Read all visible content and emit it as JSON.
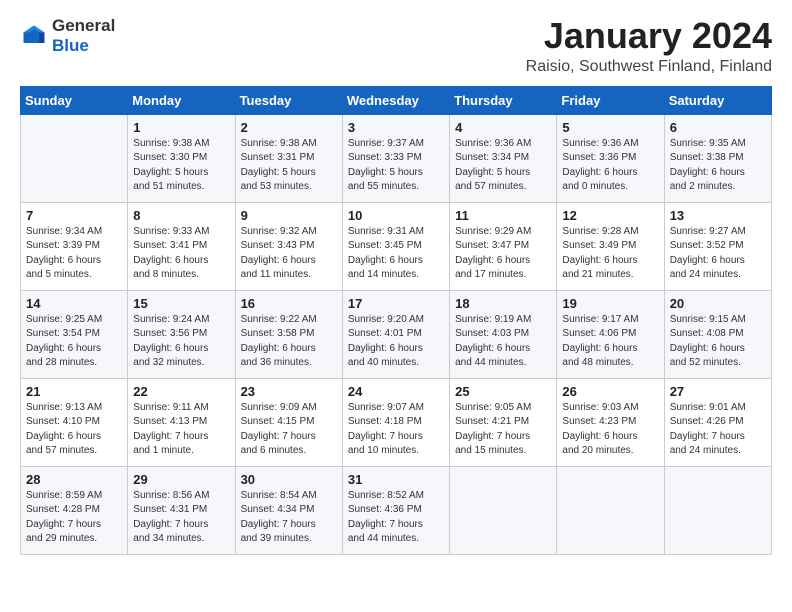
{
  "header": {
    "logo_general": "General",
    "logo_blue": "Blue",
    "month": "January 2024",
    "location": "Raisio, Southwest Finland, Finland"
  },
  "days_of_week": [
    "Sunday",
    "Monday",
    "Tuesday",
    "Wednesday",
    "Thursday",
    "Friday",
    "Saturday"
  ],
  "weeks": [
    [
      {
        "day": "",
        "info": ""
      },
      {
        "day": "1",
        "info": "Sunrise: 9:38 AM\nSunset: 3:30 PM\nDaylight: 5 hours\nand 51 minutes."
      },
      {
        "day": "2",
        "info": "Sunrise: 9:38 AM\nSunset: 3:31 PM\nDaylight: 5 hours\nand 53 minutes."
      },
      {
        "day": "3",
        "info": "Sunrise: 9:37 AM\nSunset: 3:33 PM\nDaylight: 5 hours\nand 55 minutes."
      },
      {
        "day": "4",
        "info": "Sunrise: 9:36 AM\nSunset: 3:34 PM\nDaylight: 5 hours\nand 57 minutes."
      },
      {
        "day": "5",
        "info": "Sunrise: 9:36 AM\nSunset: 3:36 PM\nDaylight: 6 hours\nand 0 minutes."
      },
      {
        "day": "6",
        "info": "Sunrise: 9:35 AM\nSunset: 3:38 PM\nDaylight: 6 hours\nand 2 minutes."
      }
    ],
    [
      {
        "day": "7",
        "info": "Sunrise: 9:34 AM\nSunset: 3:39 PM\nDaylight: 6 hours\nand 5 minutes."
      },
      {
        "day": "8",
        "info": "Sunrise: 9:33 AM\nSunset: 3:41 PM\nDaylight: 6 hours\nand 8 minutes."
      },
      {
        "day": "9",
        "info": "Sunrise: 9:32 AM\nSunset: 3:43 PM\nDaylight: 6 hours\nand 11 minutes."
      },
      {
        "day": "10",
        "info": "Sunrise: 9:31 AM\nSunset: 3:45 PM\nDaylight: 6 hours\nand 14 minutes."
      },
      {
        "day": "11",
        "info": "Sunrise: 9:29 AM\nSunset: 3:47 PM\nDaylight: 6 hours\nand 17 minutes."
      },
      {
        "day": "12",
        "info": "Sunrise: 9:28 AM\nSunset: 3:49 PM\nDaylight: 6 hours\nand 21 minutes."
      },
      {
        "day": "13",
        "info": "Sunrise: 9:27 AM\nSunset: 3:52 PM\nDaylight: 6 hours\nand 24 minutes."
      }
    ],
    [
      {
        "day": "14",
        "info": "Sunrise: 9:25 AM\nSunset: 3:54 PM\nDaylight: 6 hours\nand 28 minutes."
      },
      {
        "day": "15",
        "info": "Sunrise: 9:24 AM\nSunset: 3:56 PM\nDaylight: 6 hours\nand 32 minutes."
      },
      {
        "day": "16",
        "info": "Sunrise: 9:22 AM\nSunset: 3:58 PM\nDaylight: 6 hours\nand 36 minutes."
      },
      {
        "day": "17",
        "info": "Sunrise: 9:20 AM\nSunset: 4:01 PM\nDaylight: 6 hours\nand 40 minutes."
      },
      {
        "day": "18",
        "info": "Sunrise: 9:19 AM\nSunset: 4:03 PM\nDaylight: 6 hours\nand 44 minutes."
      },
      {
        "day": "19",
        "info": "Sunrise: 9:17 AM\nSunset: 4:06 PM\nDaylight: 6 hours\nand 48 minutes."
      },
      {
        "day": "20",
        "info": "Sunrise: 9:15 AM\nSunset: 4:08 PM\nDaylight: 6 hours\nand 52 minutes."
      }
    ],
    [
      {
        "day": "21",
        "info": "Sunrise: 9:13 AM\nSunset: 4:10 PM\nDaylight: 6 hours\nand 57 minutes."
      },
      {
        "day": "22",
        "info": "Sunrise: 9:11 AM\nSunset: 4:13 PM\nDaylight: 7 hours\nand 1 minute."
      },
      {
        "day": "23",
        "info": "Sunrise: 9:09 AM\nSunset: 4:15 PM\nDaylight: 7 hours\nand 6 minutes."
      },
      {
        "day": "24",
        "info": "Sunrise: 9:07 AM\nSunset: 4:18 PM\nDaylight: 7 hours\nand 10 minutes."
      },
      {
        "day": "25",
        "info": "Sunrise: 9:05 AM\nSunset: 4:21 PM\nDaylight: 7 hours\nand 15 minutes."
      },
      {
        "day": "26",
        "info": "Sunrise: 9:03 AM\nSunset: 4:23 PM\nDaylight: 6 hours\nand 20 minutes."
      },
      {
        "day": "27",
        "info": "Sunrise: 9:01 AM\nSunset: 4:26 PM\nDaylight: 7 hours\nand 24 minutes."
      }
    ],
    [
      {
        "day": "28",
        "info": "Sunrise: 8:59 AM\nSunset: 4:28 PM\nDaylight: 7 hours\nand 29 minutes."
      },
      {
        "day": "29",
        "info": "Sunrise: 8:56 AM\nSunset: 4:31 PM\nDaylight: 7 hours\nand 34 minutes."
      },
      {
        "day": "30",
        "info": "Sunrise: 8:54 AM\nSunset: 4:34 PM\nDaylight: 7 hours\nand 39 minutes."
      },
      {
        "day": "31",
        "info": "Sunrise: 8:52 AM\nSunset: 4:36 PM\nDaylight: 7 hours\nand 44 minutes."
      },
      {
        "day": "",
        "info": ""
      },
      {
        "day": "",
        "info": ""
      },
      {
        "day": "",
        "info": ""
      }
    ]
  ]
}
